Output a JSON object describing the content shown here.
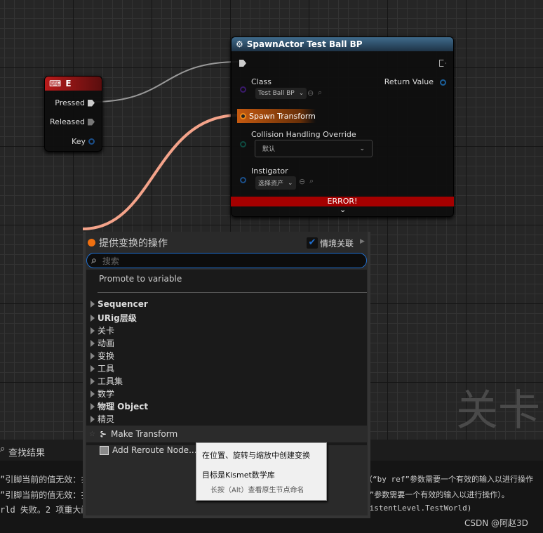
{
  "canvas": {
    "watermark_text": "关卡"
  },
  "event_node": {
    "title": "E",
    "icon": "keyboard-icon",
    "pins": [
      "Pressed",
      "Released",
      "Key"
    ]
  },
  "spawn_node": {
    "title": "SpawnActor Test Ball BP",
    "icon": "spawn-actor-icon",
    "class_label": "Class",
    "class_value": "Test Ball BP",
    "return_label": "Return Value",
    "spawn_transform_label": "Spawn Transform",
    "collision_label": "Collision Handling Override",
    "collision_value": "默认",
    "instigator_label": "Instigator",
    "instigator_value": "选择资产",
    "error_text": "ERROR!"
  },
  "action_menu": {
    "title": "提供变换的操作",
    "context_label": "情境关联",
    "context_checked": true,
    "search_placeholder": "搜索",
    "promote": "Promote to variable",
    "categories": [
      "Sequencer",
      "URig层级",
      "关卡",
      "动画",
      "变换",
      "工具",
      "工具集",
      "数学",
      "物理 Object",
      "精灵"
    ],
    "selected_item": "Make Transform",
    "reroute_item": "Add Reroute Node..."
  },
  "tooltip": {
    "description": "在位置、旋转与缩放中创建变换",
    "target": "目标是Kismet数学库",
    "hint": "长按（Alt）查看原生节点命名"
  },
  "results_panel": {
    "title": "查找结果",
    "lines_left": [
      "”引脚当前的值无效：扌",
      "”引脚当前的值无效：扌",
      "rld 失败。2 项重大问"
    ],
    "lines_right": [
      "（“by ref”参数需要一个有效的输入以进行操作",
      "f”参数需要一个有效的输入以进行操作）。",
      "sistentLevel.TestWorld)"
    ]
  },
  "credit": "CSDN @阿赵3D",
  "colors": {
    "accent": "#1f6fd1",
    "transform_pin": "#f08a1a",
    "wire_transform": "#f4a38a",
    "error": "#a50000"
  }
}
